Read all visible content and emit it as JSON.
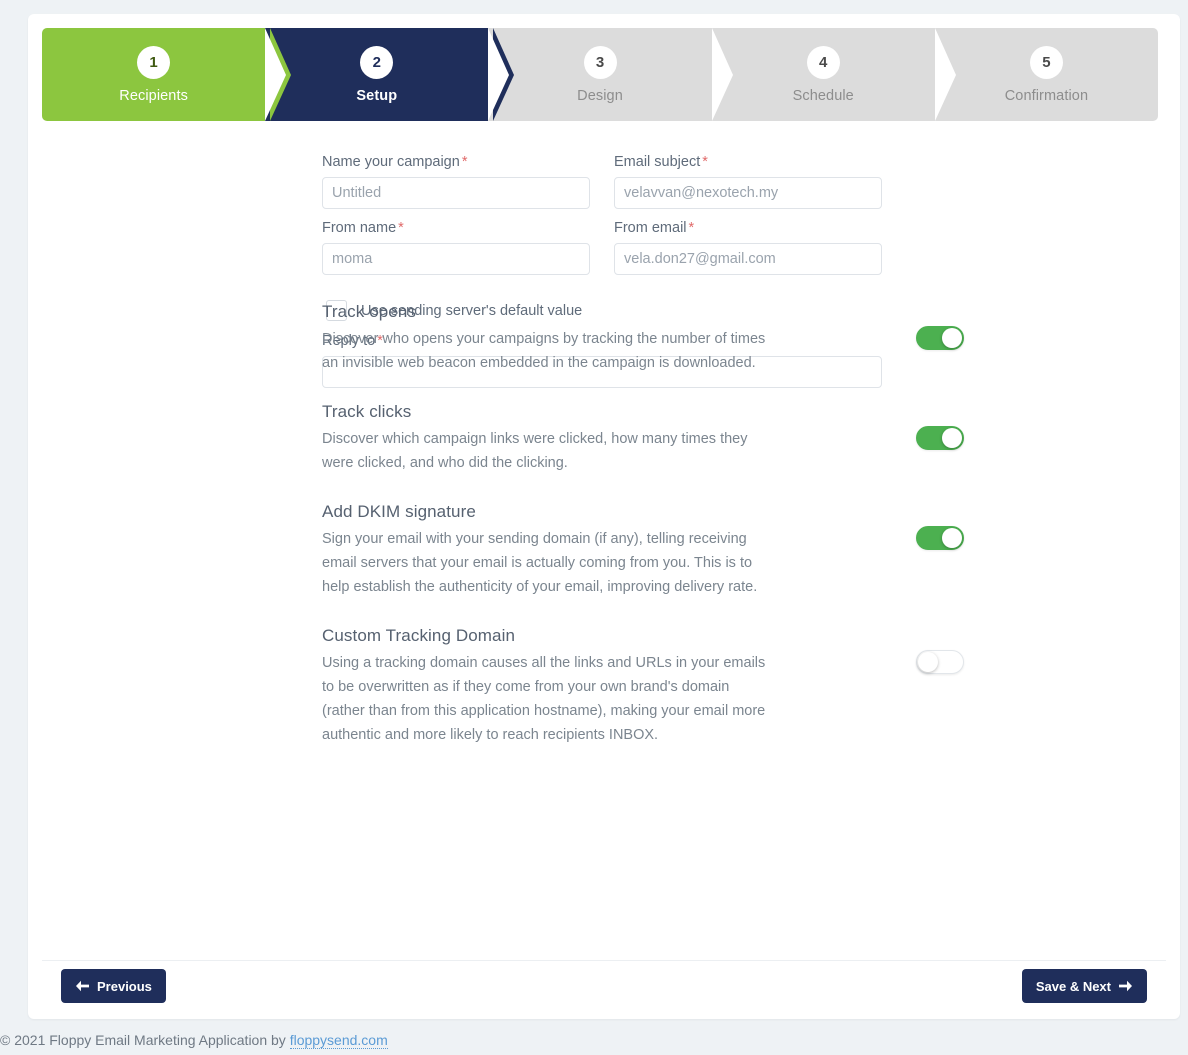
{
  "stepper": {
    "steps": [
      {
        "num": "1",
        "label": "Recipients",
        "state": "done"
      },
      {
        "num": "2",
        "label": "Setup",
        "state": "current"
      },
      {
        "num": "3",
        "label": "Design",
        "state": "upcoming"
      },
      {
        "num": "4",
        "label": "Schedule",
        "state": "upcoming"
      },
      {
        "num": "5",
        "label": "Confirmation",
        "state": "upcoming"
      }
    ]
  },
  "form": {
    "campaign_name": {
      "label": "Name your campaign",
      "required": "*",
      "value": "",
      "placeholder": "Untitled"
    },
    "email_subject": {
      "label": "Email subject",
      "required": "*",
      "value": "",
      "placeholder": "velavvan@nexotech.my"
    },
    "from_name": {
      "label": "From name",
      "required": "*",
      "value": "",
      "placeholder": "moma"
    },
    "from_email": {
      "label": "From email",
      "required": "*",
      "value": "",
      "placeholder": "vela.don27@gmail.com"
    },
    "use_default_checkbox": {
      "label": "Use sending server's default value",
      "checked": false
    },
    "reply_to": {
      "label": "Reply to",
      "required": "*",
      "value": "",
      "placeholder": ""
    }
  },
  "settings": [
    {
      "title": "Track opens",
      "description": "Discover who opens your campaigns by tracking the number of times an invisible web beacon embedded in the campaign is downloaded.",
      "toggle_state": "on"
    },
    {
      "title": "Track clicks",
      "description": "Discover which campaign links were clicked, how many times they were clicked, and who did the clicking.",
      "toggle_state": "on"
    },
    {
      "title": "Add DKIM signature",
      "description": "Sign your email with your sending domain (if any), telling receiving email servers that your email is actually coming from you. This is to help establish the authenticity of your email, improving delivery rate.",
      "toggle_state": "on"
    },
    {
      "title": "Custom Tracking Domain",
      "description": "Using a tracking domain causes all the links and URLs in your emails to be overwritten as if they come from your own brand's domain (rather than from this application hostname), making your email more authentic and more likely to reach recipients INBOX.",
      "toggle_state": "off"
    }
  ],
  "footer": {
    "previous_label": "Previous",
    "previous_icon": "arrow-left-icon",
    "next_label": "Save & Next",
    "next_icon": "arrow-right-icon",
    "copyright_text": "© 2021 Floppy Email Marketing Application by",
    "copyright_link": "floppysend.com"
  },
  "colors": {
    "done": "#8cc63f",
    "current": "#1f2e5b",
    "upcoming": "#dcdcdc",
    "toggle_on": "#4cb050",
    "required": "#e06a6a",
    "link": "#5b9bd5",
    "page_bg": "#eef2f5"
  }
}
